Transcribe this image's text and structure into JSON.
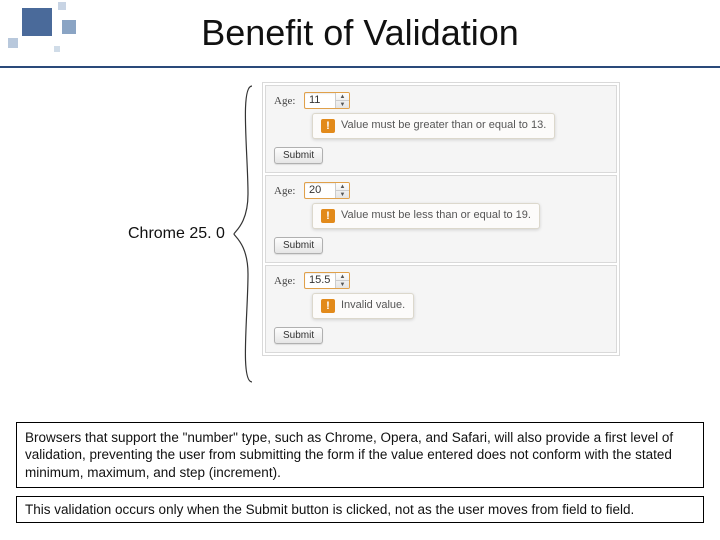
{
  "title": "Benefit of Validation",
  "browserLabel": "Chrome 25. 0",
  "panels": [
    {
      "label": "Age:",
      "value": "11",
      "message": "Value must be greater than or equal to 13.",
      "submit": "Submit"
    },
    {
      "label": "Age:",
      "value": "20",
      "message": "Value must be less than or equal to 19.",
      "submit": "Submit"
    },
    {
      "label": "Age:",
      "value": "15.5",
      "message": "Invalid value.",
      "submit": "Submit"
    }
  ],
  "footer1": "Browsers that support the \"number\" type, such as Chrome, Opera, and Safari, will also provide a first level of validation, preventing the user from submitting the form if the value entered does not conform with the stated minimum, maximum, and step (increment).",
  "footer2": "This validation occurs only when the Submit button is clicked, not as the user moves from field to field."
}
